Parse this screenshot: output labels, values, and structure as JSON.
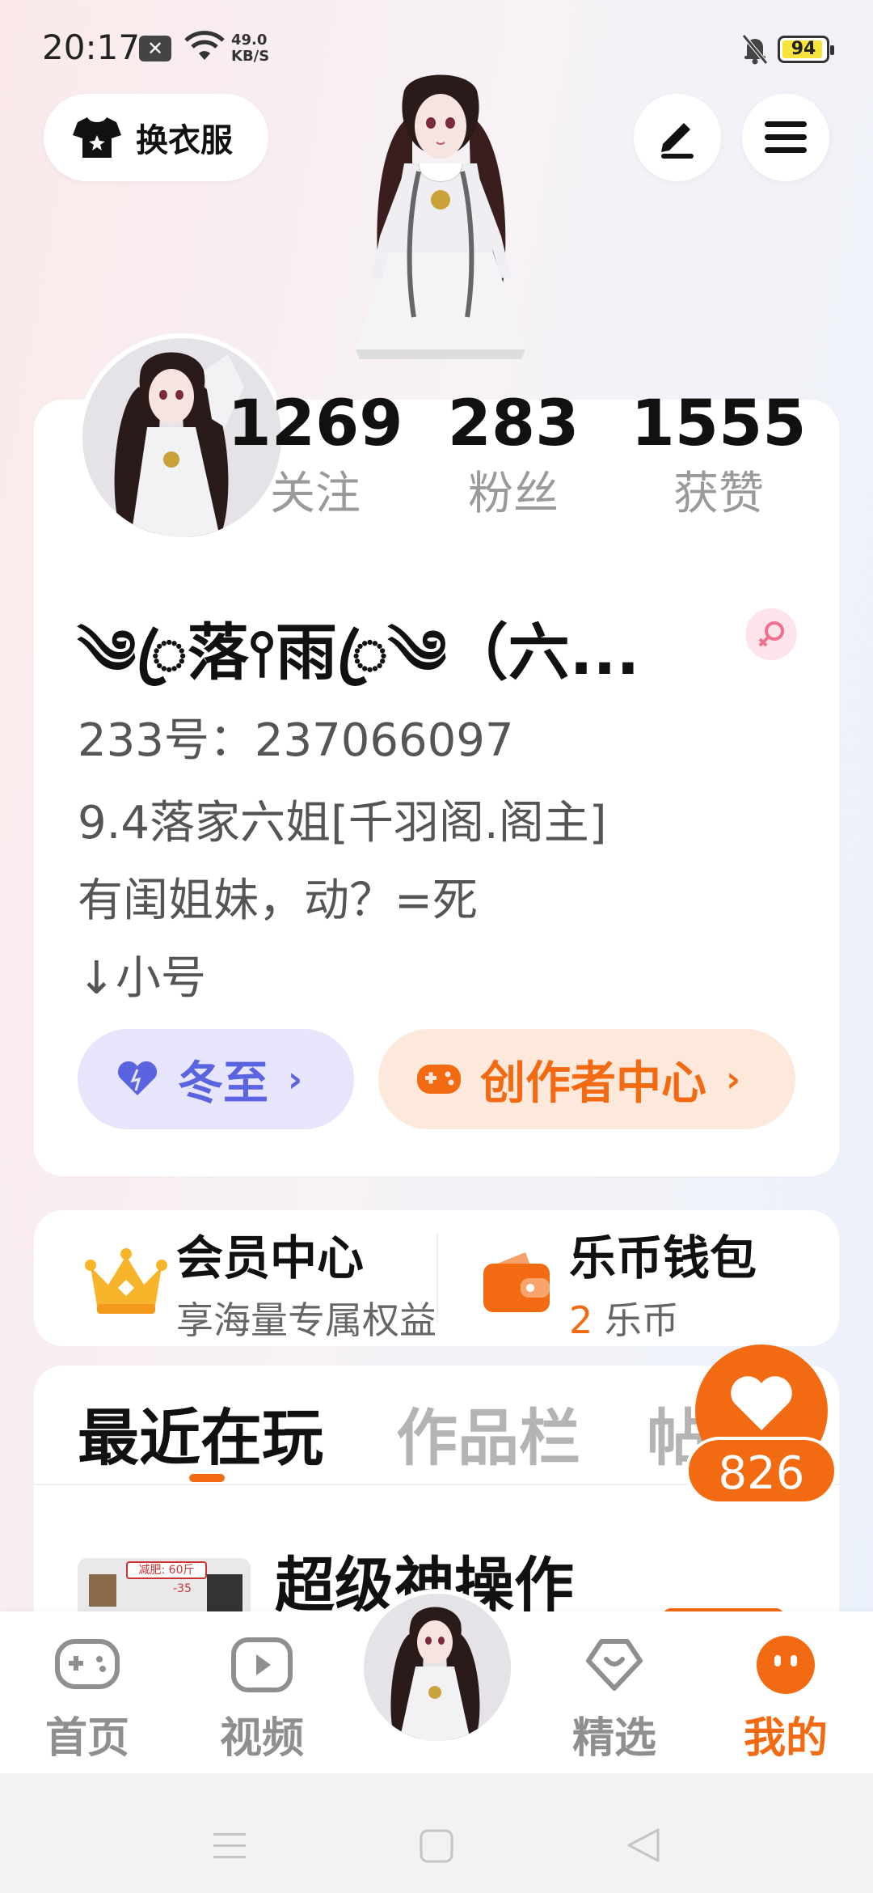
{
  "status_bar": {
    "time": "20:17",
    "notice_icon": "close-box-icon",
    "speed_value": "49.0",
    "speed_unit": "KB/S",
    "battery": "94",
    "battery_level": 0.94
  },
  "top": {
    "dress_button_label": "换衣服",
    "edit_icon": "pen-icon",
    "menu_icon": "menu-icon"
  },
  "profile": {
    "stats": [
      {
        "value": "1269",
        "label": "关注"
      },
      {
        "value": "283",
        "label": "粉丝"
      },
      {
        "value": "1555",
        "label": "获赞"
      }
    ],
    "nickname": "༄ꦿ落⫯雨ꦿ༄（六...",
    "gender_icon": "female-icon",
    "id_text": "233号：237066097",
    "bio": "9.4落家六姐[千羽阁.阁主]\n有闺姐妹，动？=死\n↓小号",
    "pill_left_label": "冬至",
    "pill_right_label": "创作者中心"
  },
  "member": {
    "vip_title": "会员中心",
    "vip_sub": "享海量专属权益",
    "wallet_title": "乐币钱包",
    "wallet_amount": "2",
    "wallet_unit": "乐币"
  },
  "tabs": {
    "items": [
      "最近在玩",
      "作品栏",
      "帖"
    ],
    "active": 0
  },
  "recent": {
    "game_title": "超级神操作",
    "thumb_label": "减肥: 60斤",
    "thumb_sub": "-35"
  },
  "float_like": {
    "count": "826"
  },
  "bottom_nav": {
    "items": [
      {
        "label": "首页",
        "icon": "gamepad-icon"
      },
      {
        "label": "视频",
        "icon": "play-icon"
      },
      {
        "label": "",
        "icon": "avatar-center"
      },
      {
        "label": "精选",
        "icon": "heart-chat-icon"
      },
      {
        "label": "我的",
        "icon": "smile-icon"
      }
    ],
    "active": 4
  },
  "colors": {
    "accent": "#f26a12",
    "purple": "#5a63e0"
  }
}
